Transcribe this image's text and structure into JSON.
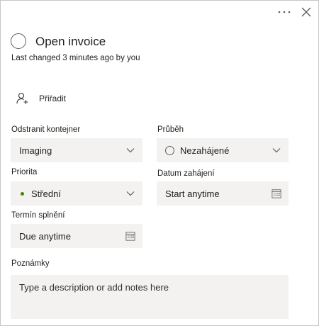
{
  "header": {
    "more_icon": "ellipsis-icon",
    "close_icon": "close-icon"
  },
  "task": {
    "title": "Open invoice",
    "last_changed": "Last changed 3 minutes ago by you"
  },
  "assign": {
    "label": "Přiřadit",
    "icon": "add-person-icon"
  },
  "fields": {
    "bucket": {
      "label": "Odstranit kontejner",
      "value": "Imaging"
    },
    "progress": {
      "label": "Průběh",
      "value": "Nezahájené"
    },
    "priority": {
      "label": "Priorita",
      "value": "Střední",
      "dot_color": "#498205"
    },
    "start_date": {
      "label": "Datum zahájení",
      "value": "Start anytime"
    },
    "due_date": {
      "label": "Termín splnění",
      "value": "Due anytime"
    }
  },
  "notes": {
    "label": "Poznámky",
    "placeholder": "Type a description or add notes here"
  }
}
